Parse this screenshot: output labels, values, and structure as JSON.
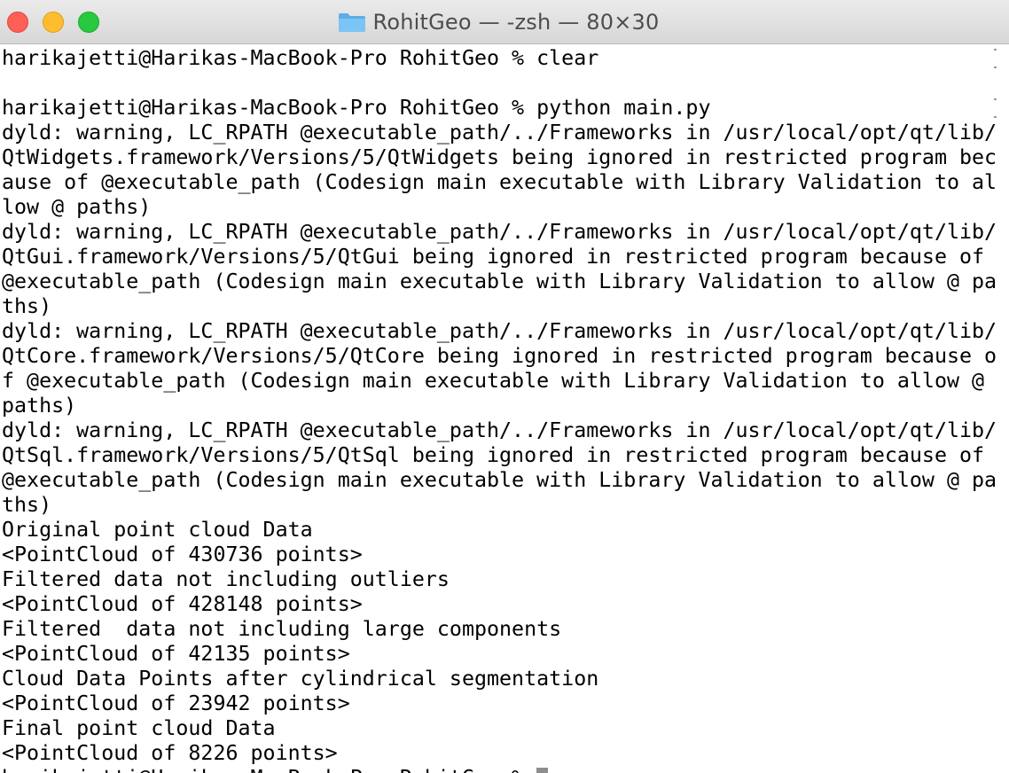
{
  "window": {
    "title": "RohitGeo — -zsh — 80×30",
    "folder_icon": "folder-icon",
    "controls": {
      "close": "close-icon",
      "minimize": "minimize-icon",
      "maximize": "maximize-icon"
    }
  },
  "terminal": {
    "lines": [
      "harikajetti@Harikas-MacBook-Pro RohitGeo % clear",
      "",
      "harikajetti@Harikas-MacBook-Pro RohitGeo % python main.py",
      "dyld: warning, LC_RPATH @executable_path/../Frameworks in /usr/local/opt/qt/lib/",
      "QtWidgets.framework/Versions/5/QtWidgets being ignored in restricted program bec",
      "ause of @executable_path (Codesign main executable with Library Validation to al",
      "low @ paths)",
      "dyld: warning, LC_RPATH @executable_path/../Frameworks in /usr/local/opt/qt/lib/",
      "QtGui.framework/Versions/5/QtGui being ignored in restricted program because of",
      "@executable_path (Codesign main executable with Library Validation to allow @ pa",
      "ths)",
      "dyld: warning, LC_RPATH @executable_path/../Frameworks in /usr/local/opt/qt/lib/",
      "QtCore.framework/Versions/5/QtCore being ignored in restricted program because o",
      "f @executable_path (Codesign main executable with Library Validation to allow @",
      "paths)",
      "dyld: warning, LC_RPATH @executable_path/../Frameworks in /usr/local/opt/qt/lib/",
      "QtSql.framework/Versions/5/QtSql being ignored in restricted program because of",
      "@executable_path (Codesign main executable with Library Validation to allow @ pa",
      "ths)",
      "Original point cloud Data",
      "<PointCloud of 430736 points>",
      "Filtered data not including outliers",
      "<PointCloud of 428148 points>",
      "Filtered  data not including large components",
      "<PointCloud of 42135 points>",
      "Cloud Data Points after cylindrical segmentation",
      "<PointCloud of 23942 points>",
      "Final point cloud Data",
      "<PointCloud of 8226 points>"
    ],
    "prompt": "harikajetti@Harikas-MacBook-Pro RohitGeo % "
  }
}
